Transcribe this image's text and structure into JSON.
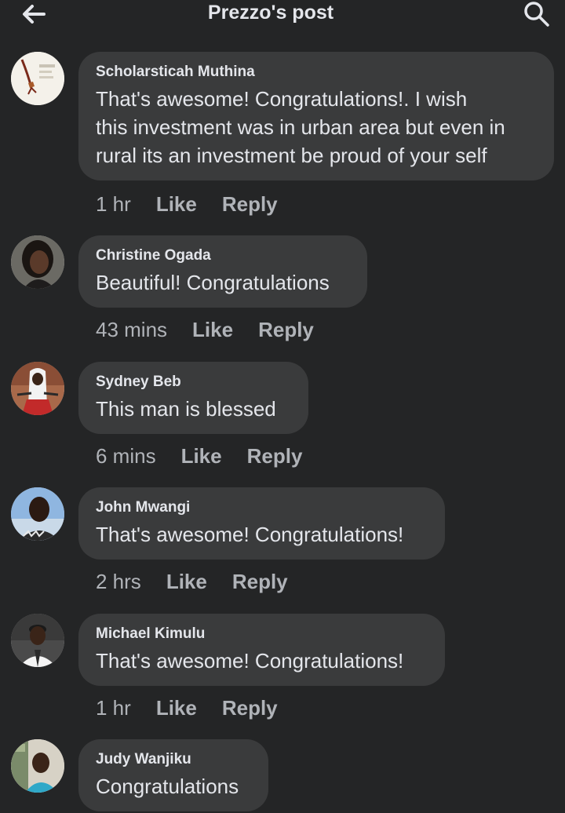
{
  "header": {
    "title": "Prezzo's post",
    "back_icon": "arrow-left-icon",
    "search_icon": "search-icon"
  },
  "colors": {
    "background": "#242526",
    "bubble": "#3a3b3c",
    "primary_text": "#e4e6eb",
    "secondary_text": "#b0b3b8"
  },
  "comments": [
    {
      "author": "Scholarsticah Muthina",
      "lines": [
        "That's awesome! Congratulations!. I wish",
        "this investment was in urban area but even in",
        "rural its an investment be proud of your self"
      ],
      "time": "1 hr",
      "like": "Like",
      "reply": "Reply"
    },
    {
      "author": "Christine Ogada",
      "lines": [
        "Beautiful! Congratulations"
      ],
      "time": "43 mins",
      "like": "Like",
      "reply": "Reply"
    },
    {
      "author": "Sydney Beb",
      "lines": [
        "This man is blessed"
      ],
      "time": "6 mins",
      "like": "Like",
      "reply": "Reply"
    },
    {
      "author": "John Mwangi",
      "lines": [
        "That's awesome! Congratulations!"
      ],
      "time": "2 hrs",
      "like": "Like",
      "reply": "Reply"
    },
    {
      "author": "Michael Kimulu",
      "lines": [
        "That's awesome! Congratulations!"
      ],
      "time": "1 hr",
      "like": "Like",
      "reply": "Reply"
    },
    {
      "author": "Judy Wanjiku",
      "lines": [
        "Congratulations"
      ]
    }
  ]
}
